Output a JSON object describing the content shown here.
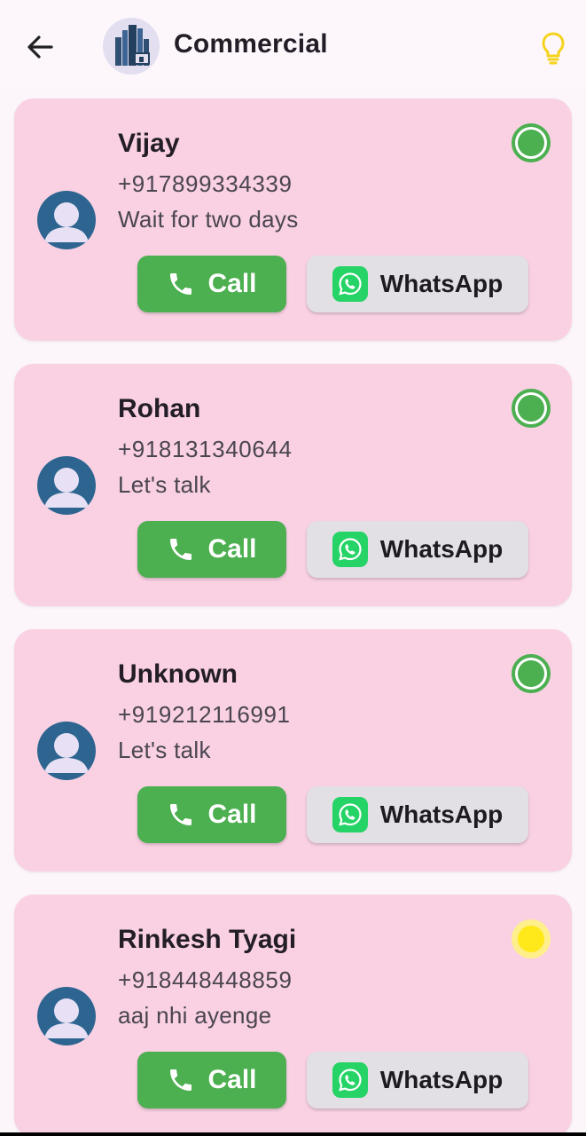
{
  "header": {
    "title": "Commercial",
    "back_icon": "arrow-left-icon",
    "logo_icon": "building-logo",
    "bulb_icon": "lightbulb-icon",
    "bulb_color": "#f5d31c"
  },
  "buttons": {
    "call_label": "Call",
    "whatsapp_label": "WhatsApp"
  },
  "colors": {
    "card_bg": "#f9d1e3",
    "call_button": "#4caf50",
    "whatsapp_button": "#e2e0e4",
    "status_green": "#4caf50",
    "status_yellow": "#ffe91a",
    "avatar": "#2d6590"
  },
  "contacts": [
    {
      "name": "Vijay",
      "phone": "+917899334339",
      "note": "Wait for two days",
      "status": "green"
    },
    {
      "name": "Rohan",
      "phone": "+918131340644",
      "note": "Let's talk",
      "status": "green"
    },
    {
      "name": "Unknown",
      "phone": "+919212116991",
      "note": "Let's talk",
      "status": "green"
    },
    {
      "name": "Rinkesh Tyagi",
      "phone": "+918448448859",
      "note": "aaj nhi ayenge",
      "status": "yellow"
    }
  ]
}
